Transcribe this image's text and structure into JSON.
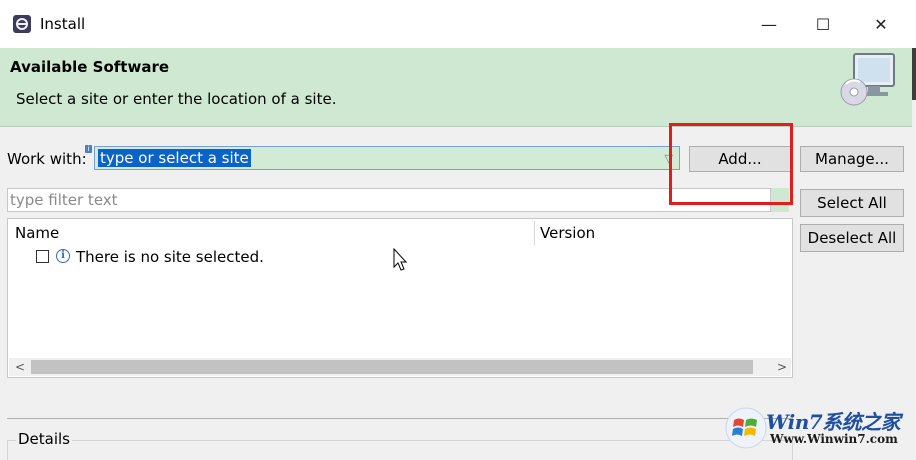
{
  "window": {
    "title": "Install",
    "controls": {
      "minimize": "—",
      "maximize": "☐",
      "close": "✕"
    }
  },
  "banner": {
    "title": "Available Software",
    "message": "Select a site or enter the location of a site.",
    "image_icon": "cd-monitor-icon"
  },
  "work_with": {
    "label": "Work with:",
    "value": "type or select a site"
  },
  "buttons": {
    "add": "Add...",
    "manage": "Manage...",
    "select_all": "Select All",
    "deselect_all": "Deselect All"
  },
  "filter": {
    "placeholder": "type filter text"
  },
  "tree": {
    "columns": [
      "Name",
      "Version"
    ],
    "rows": [
      {
        "checked": false,
        "icon": "info-icon",
        "text": "There is no site selected."
      }
    ]
  },
  "details": {
    "label": "Details"
  },
  "watermark": {
    "brand": "Win7系统之家",
    "url": "Www.Winwin7.com"
  },
  "colors": {
    "banner_bg": "#cfe8d2",
    "selection": "#0a63c9",
    "highlight_box": "#e21d1d"
  }
}
